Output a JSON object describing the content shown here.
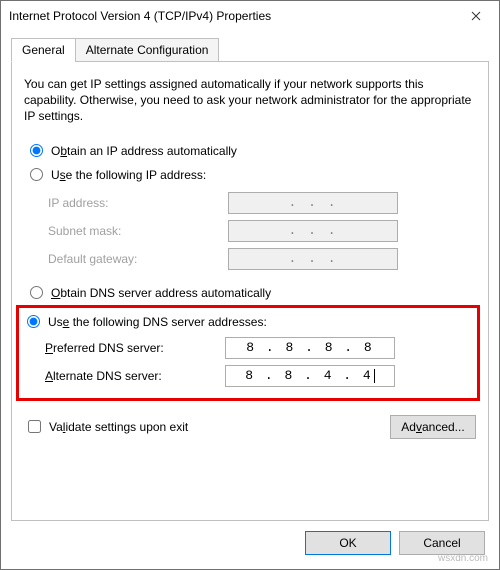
{
  "window": {
    "title": "Internet Protocol Version 4 (TCP/IPv4) Properties"
  },
  "tabs": {
    "general": "General",
    "alternate": "Alternate Configuration"
  },
  "description": "You can get IP settings assigned automatically if your network supports this capability. Otherwise, you need to ask your network administrator for the appropriate IP settings.",
  "ip_section": {
    "auto_label_pre": "O",
    "auto_label_key": "b",
    "auto_label_post": "tain an IP address automatically",
    "manual_label_pre": "U",
    "manual_label_key": "s",
    "manual_label_post": "e the following IP address:",
    "ip_address_label": "IP address:",
    "subnet_label": "Subnet mask:",
    "gateway_label": "Default gateway:",
    "dots": ".       .       .",
    "selected": "auto"
  },
  "dns_section": {
    "auto_label": "Obtain DNS server address automatically",
    "manual_label": "Use the following DNS server addresses:",
    "preferred_label": "Preferred DNS server:",
    "alternate_label": "Alternate DNS server:",
    "preferred_value": "8 . 8 . 8 . 8",
    "alternate_value": "8 . 8 . 4 . 4",
    "selected": "manual"
  },
  "validate_label": "Validate settings upon exit",
  "buttons": {
    "advanced": "Advanced...",
    "ok": "OK",
    "cancel": "Cancel"
  },
  "watermark": "wsxdn.com"
}
